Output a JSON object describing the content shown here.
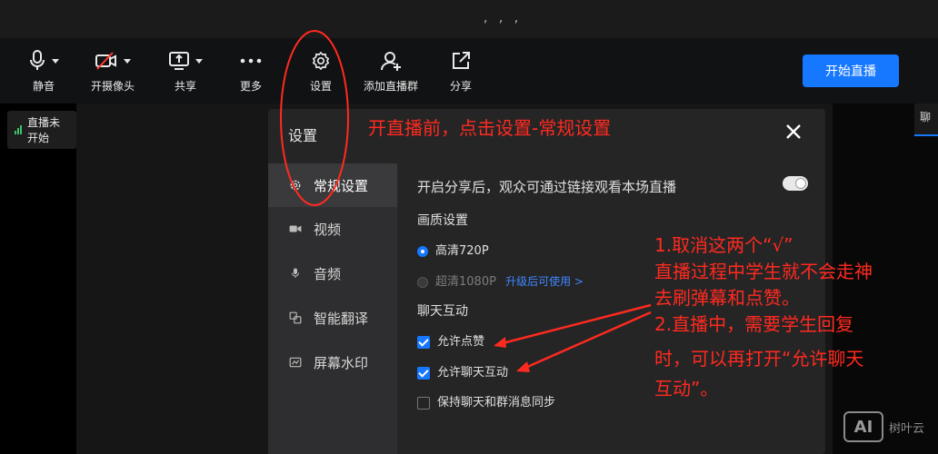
{
  "window": {
    "title_dots": ", , ,"
  },
  "toolbar": {
    "mute": "静音",
    "camera": "开摄像头",
    "share_screen": "共享",
    "more": "更多",
    "settings": "设置",
    "add_group": "添加直播群",
    "share": "分享",
    "start_live": "开始直播"
  },
  "status": {
    "live_state": "直播未开始"
  },
  "right_panel": {
    "tab_label": "聊"
  },
  "dialog": {
    "title": "设置",
    "sidebar": [
      "常规设置",
      "视频",
      "音频",
      "智能翻译",
      "屏幕水印"
    ],
    "share_option": "开启分享后，观众可通过链接观看本场直播",
    "quality_heading": "画质设置",
    "quality_720": "高清720P",
    "quality_1080": "超清1080P",
    "upgrade_link": "升级后可使用 >",
    "chat_heading": "聊天互动",
    "allow_like": "允许点赞",
    "allow_chat": "允许聊天互动",
    "sync_chat": "保持聊天和群消息同步"
  },
  "annotations": {
    "title": "开直播前，点击设置-常规设置",
    "lines": [
      "1.取消这两个“√”",
      "直播过程中学生就不会走神",
      "去刷弹幕和点赞。",
      "2.直播中，需要学生回复",
      "时，可以再打开“允许聊天",
      "互动”。"
    ]
  },
  "watermark": {
    "logo": "AI",
    "text": "树叶云"
  },
  "colors": {
    "accent": "#1677ff",
    "annotation": "#ff2a1f",
    "signal": "#39c26b"
  }
}
